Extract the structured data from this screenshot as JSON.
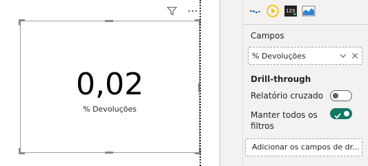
{
  "visual": {
    "kpi_value": "0,02",
    "kpi_label": "% Devoluções",
    "header_icons": [
      "filter-icon",
      "more-options-icon"
    ]
  },
  "pane": {
    "viz_icons": [
      "waterfall-chart-icon",
      "kpi-gauge-icon",
      "card-icon",
      "area-chart-icon"
    ],
    "fields_heading": "Campos",
    "field_value": "% Devoluções",
    "drillthrough_heading": "Drill-through",
    "cross_report_label": "Relatório cruzado",
    "cross_report_state": "off",
    "keep_filters_label_line1": "Manter todos os",
    "keep_filters_label_line2": "filtros",
    "keep_filters_state": "on",
    "add_fields_placeholder": "Adicionar os campos de dr...",
    "accent_color": "#117865"
  }
}
